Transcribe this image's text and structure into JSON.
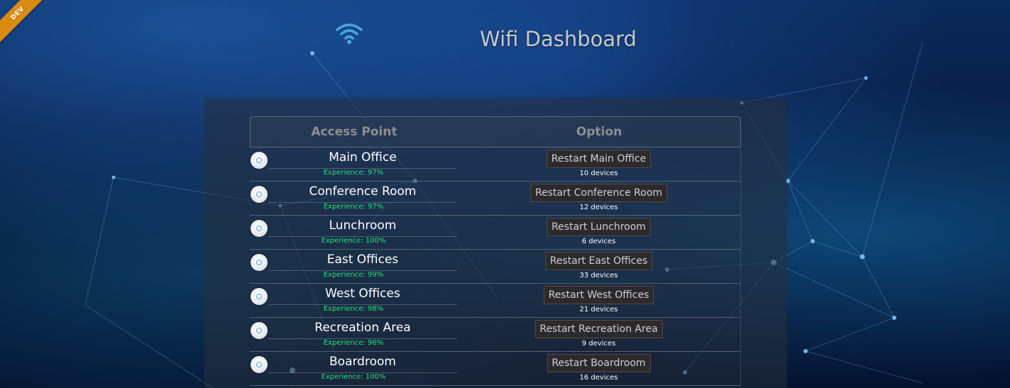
{
  "ribbon": {
    "label": "DEV"
  },
  "header": {
    "icon": "wifi-icon",
    "title": "Wifi Dashboard"
  },
  "table": {
    "headers": {
      "access_point": "Access Point",
      "option": "Option"
    },
    "rows": [
      {
        "name": "Main Office",
        "experience": "Experience: 97%",
        "button": "Restart Main Office",
        "devices": "10 devices"
      },
      {
        "name": "Conference Room",
        "experience": "Experience: 97%",
        "button": "Restart Conference Room",
        "devices": "12 devices"
      },
      {
        "name": "Lunchroom",
        "experience": "Experience: 100%",
        "button": "Restart Lunchroom",
        "devices": "6 devices"
      },
      {
        "name": "East Offices",
        "experience": "Experience: 99%",
        "button": "Restart East Offices",
        "devices": "33 devices"
      },
      {
        "name": "West Offices",
        "experience": "Experience: 98%",
        "button": "Restart West Offices",
        "devices": "21 devices"
      },
      {
        "name": "Recreation Area",
        "experience": "Experience: 96%",
        "button": "Restart Recreation Area",
        "devices": "9 devices"
      },
      {
        "name": "Boardroom",
        "experience": "Experience: 100%",
        "button": "Restart Boardroom",
        "devices": "16 devices"
      }
    ]
  },
  "colors": {
    "experience": "#21e07a",
    "ribbon": "#d88a12",
    "wifi_icon": "#4aa8d8"
  }
}
